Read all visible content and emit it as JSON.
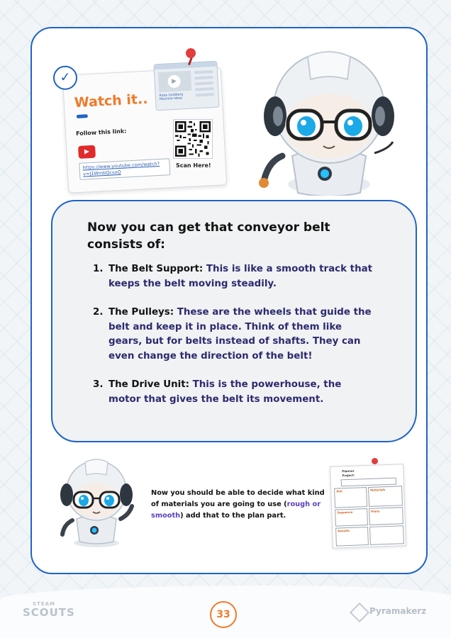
{
  "watch": {
    "title": "Watch it..",
    "follow_label": "Follow this link:",
    "link": "https://www.youtube.com/watch?v=J1WmbQcsoQ",
    "scan_label": "Scan Here!",
    "video_caption": "Rube Goldberg Machine Ideas"
  },
  "panel": {
    "heading": "Now you can get that conveyor belt consists of:",
    "items": [
      {
        "num": "1.",
        "term": "The Belt Support:",
        "text": " This is like a smooth track that keeps the belt moving steadily."
      },
      {
        "num": "2.",
        "term": "The Pulleys:",
        "text": " These are the wheels that guide the belt and keep it in place. Think of them like gears, but for belts instead of shafts. They can even change the direction of the belt!"
      },
      {
        "num": "3.",
        "term": "The Drive Unit:",
        "text": " This is the powerhouse, the motor that gives the belt its movement."
      }
    ]
  },
  "bottom": {
    "text_before": "Now you should be able to decide what kind of materials you are going to use (",
    "highlight": "rough or smooth",
    "text_after": ") add that to the plan part."
  },
  "plan_card": {
    "title": "Planner",
    "subtitle": "Project:",
    "cells": [
      "Aim",
      "Materials",
      "Sequence",
      "Plans",
      "Results"
    ]
  },
  "footer": {
    "logo_top": "STEAM",
    "logo_bottom": "SCOUTS",
    "page_number": "33",
    "brand": "Pyramakerz"
  },
  "colors": {
    "frame_blue": "#1f63c7",
    "accent_orange": "#f07a2a",
    "text_navy": "#2d2a6e"
  }
}
